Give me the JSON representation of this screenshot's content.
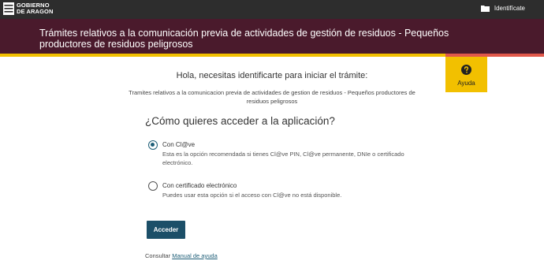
{
  "header": {
    "logo_line1": "GOBIERNO",
    "logo_line2": "DE ARAGON",
    "identify_label": "Identifícate"
  },
  "title_bar": {
    "title": "Trámites relativos a la comunicación previa de actividades de gestión de residuos  - Pequeños productores de residuos peligrosos"
  },
  "help": {
    "label": "Ayuda",
    "icon": "question-circle-icon"
  },
  "main": {
    "greeting": "Hola, necesitas identificarte para iniciar el trámite:",
    "procedure": "Tramites relativos a la comunicacion previa de actividades de gestion de residuos  - Pequeños productores de residuos peligrosos",
    "question": "¿Cómo quieres acceder a la aplicación?",
    "options": [
      {
        "label": "Con Cl@ve",
        "description": "Esta es la opción recomendada si tienes Cl@ve PIN, Cl@ve permanente, DNIe o certificado electrónico.",
        "selected": true
      },
      {
        "label": "Con certificado electrónico",
        "description": "Puedes usar esta opción si el acceso con Cl@ve no está disponible.",
        "selected": false
      }
    ],
    "submit_label": "Acceder",
    "consult_prefix": "Consultar",
    "manual_link": "Manual de ayuda"
  },
  "colors": {
    "topbar": "#2d2d2d",
    "titlebar": "#4a1a2c",
    "accent_yellow": "#f2c000",
    "accent_red": "#e0584a",
    "button": "#1c4f68"
  }
}
